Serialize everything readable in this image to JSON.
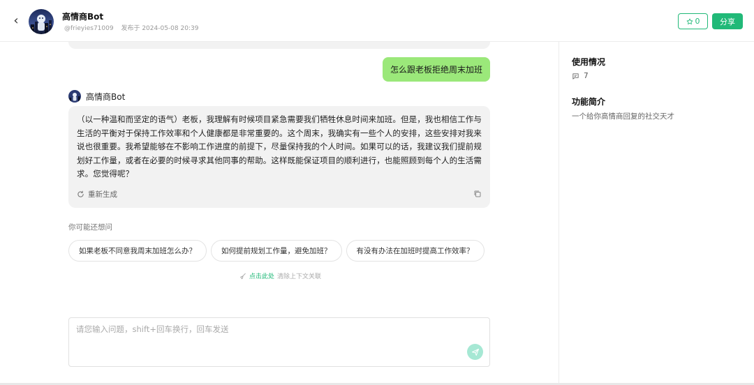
{
  "header": {
    "bot_name": "高情商Bot",
    "handle": "@frieyies71009",
    "published": "发布于 2024-05-08 20:39",
    "fav_count": "0",
    "share_label": "分享"
  },
  "chat": {
    "user_message": "怎么跟老板拒绝周末加班",
    "reply_name": "高情商Bot",
    "reply_text": "（以一种温和而坚定的语气）老板，我理解有时候项目紧急需要我们牺牲休息时间来加班。但是，我也相信工作与生活的平衡对于保持工作效率和个人健康都是非常重要的。这个周末，我确实有一些个人的安排，这些安排对我来说也很重要。我希望能够在不影响工作进度的前提下，尽量保持我的个人时间。如果可以的话，我建议我们提前规划好工作量，或者在必要的时候寻求其他同事的帮助。这样既能保证项目的顺利进行，也能照顾到每个人的生活需求。您觉得呢？",
    "regenerate_label": "重新生成",
    "suggest_title": "你可能还想问",
    "suggestions": [
      "如果老板不同意我周末加班怎么办？",
      "如何提前规划工作量，避免加班？",
      "有没有办法在加班时提高工作效率？"
    ],
    "clear_link": "点击此处",
    "clear_desc": "清除上下文关联",
    "input_placeholder": "请您输入问题，shift+回车换行，回车发送"
  },
  "side": {
    "usage_title": "使用情况",
    "usage_count": "7",
    "intro_title": "功能简介",
    "intro_text": "一个给你高情商回复的社交天才"
  },
  "colors": {
    "accent": "#21b978",
    "user_bubble": "#9be87a",
    "bot_bubble": "#f2f2f2"
  },
  "icons": {
    "back": "chevron-left-icon",
    "star": "star-icon",
    "regenerate": "refresh-icon",
    "copy": "copy-icon",
    "clear": "broom-icon",
    "send": "send-icon",
    "usage": "message-icon"
  }
}
